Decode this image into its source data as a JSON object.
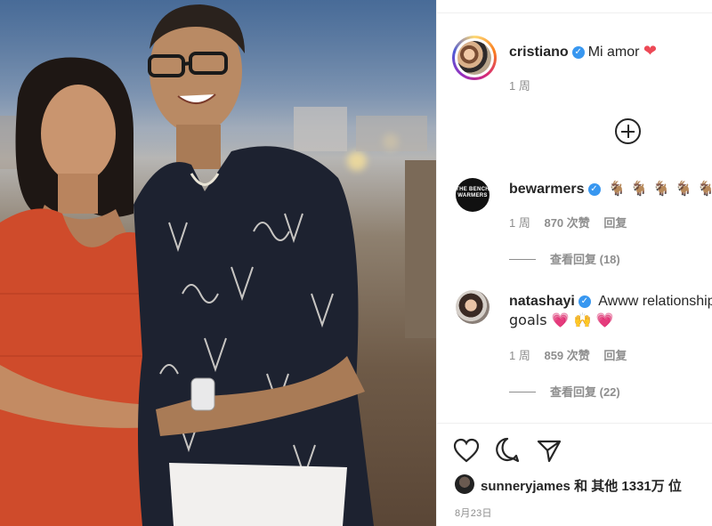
{
  "post": {
    "author": "cristiano",
    "caption": "Mi amor",
    "caption_emoji": "❤",
    "time": "1 周",
    "likes_user": "sunneryjames",
    "likes_text": "和 其他 1331万 位",
    "date": "8月23日"
  },
  "comments": [
    {
      "user": "bewarmers",
      "text": "🐐 🐐 🐐 🐐 🐐",
      "time": "1 周",
      "likes": "870 次赞",
      "reply": "回复",
      "view_replies": "查看回复 (18)",
      "avatar_text": "THE BENCH WARMERS"
    },
    {
      "user": "natashayi",
      "text": "Awww relationship",
      "text_line2": "goals 💗 🙌 💗",
      "time": "1 周",
      "likes": "859 次赞",
      "reply": "回复",
      "view_replies": "查看回复 (22)"
    }
  ],
  "icons": [
    "heart-icon",
    "comment-icon",
    "share-icon",
    "load-more-plus-icon",
    "verified-badge-icon"
  ],
  "colors": {
    "verified": "#3897f0",
    "heart": "#ed4956",
    "muted": "#8e8e8e"
  }
}
